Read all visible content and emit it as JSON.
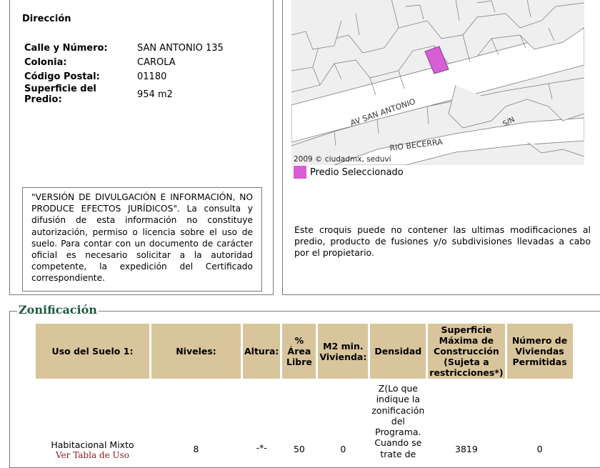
{
  "direccion": {
    "title": "Dirección",
    "fields": [
      {
        "label": "Calle y Número:",
        "value": "SAN ANTONIO 135"
      },
      {
        "label": "Colonia:",
        "value": "CAROLA"
      },
      {
        "label": "Código Postal:",
        "value": "01180"
      },
      {
        "label": "Superficie del Predio:",
        "value": "954 m2"
      }
    ]
  },
  "notice": "\"VERSIÓN DE DIVULGACIÓN E INFORMACIÓN, NO PRODUCE EFECTOS JURÍDICOS\". La consulta y difusión de esta información no constituye autorización, permiso o licencia sobre el uso de suelo. Para contar con un documento de carácter oficial es necesario solicitar a la autoridad competente, la expedición del Certificado correspondiente.",
  "map": {
    "street_labels": [
      "AV SAN ANTONIO",
      "RIO BECERRA",
      "S/N"
    ],
    "copyright": "2009 © ciudadmx, seduvi",
    "legend_label": "Predio Seleccionado",
    "legend_color": "#d65fd6",
    "croquis_note": "Este croquis puede no contener las ultimas modificaciones al predio, producto de fusiones y/o subdivisiones llevadas a cabo por el propietario."
  },
  "zonificacion": {
    "title": "Zonificación",
    "headers": [
      "Uso del Suelo 1:",
      "Niveles:",
      "Altura:",
      "% Área Libre",
      "M2 min. Vivienda:",
      "Densidad",
      "Superficie Máxima de Construcción (Sujeta a restricciones*)",
      "Número de Viviendas Permitidas"
    ],
    "row": {
      "uso": "Habitacional Mixto",
      "ver_tabla": "Ver Tabla de Uso",
      "niveles": "8",
      "altura": "-*-",
      "area_libre": "50",
      "m2_min": "0",
      "densidad": "Z(Lo que indique la zonificación del Programa. Cuando se trate de",
      "superficie": "3819",
      "viviendas": "0"
    }
  }
}
